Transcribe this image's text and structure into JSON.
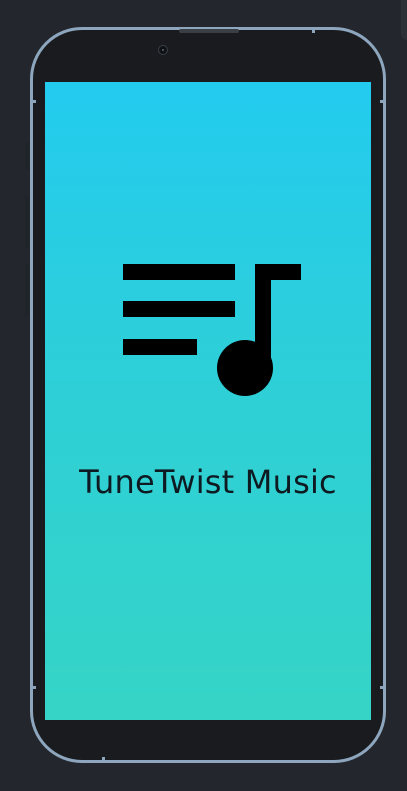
{
  "app": {
    "name": "TuneTwist Music",
    "logo_icon": "music-playlist-icon"
  },
  "colors": {
    "screen_gradient_top": "#23cbef",
    "screen_gradient_bottom": "#36d4c6",
    "frame_border": "#8da6bd",
    "background": "#23272d",
    "text": "#0e1a22"
  }
}
